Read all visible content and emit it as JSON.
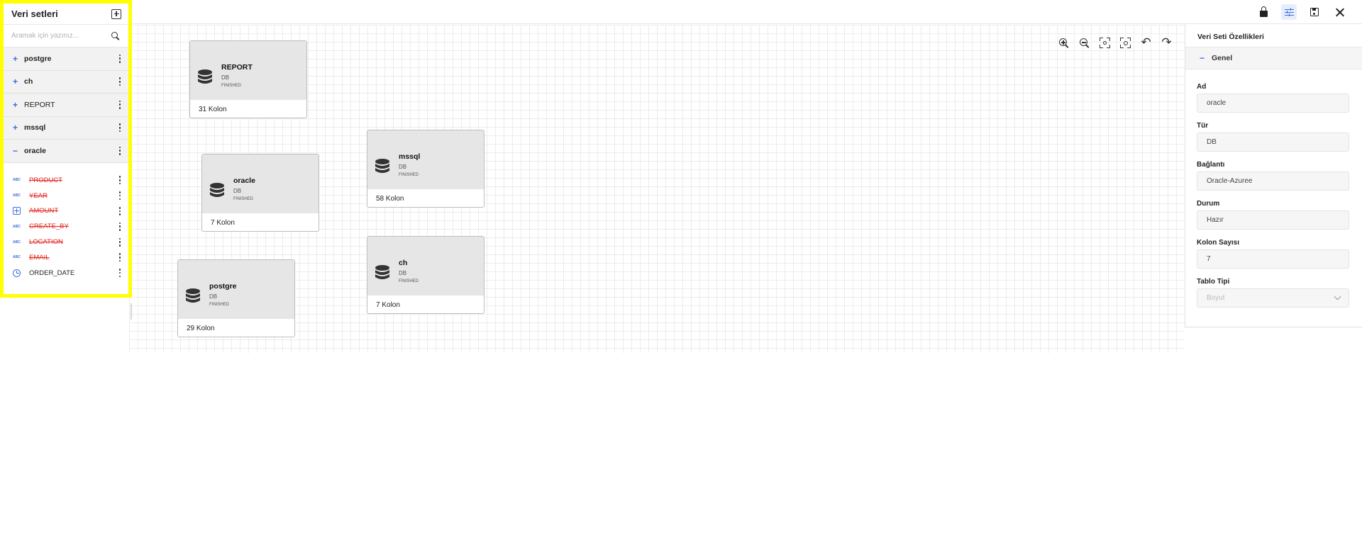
{
  "sidebar": {
    "title": "Veri setleri",
    "search_placeholder": "Aramak için yazınız...",
    "datasets": [
      {
        "sign": "+",
        "label": "postgre"
      },
      {
        "sign": "+",
        "label": "ch"
      },
      {
        "sign": "+",
        "label": "REPORT"
      },
      {
        "sign": "+",
        "label": "mssql"
      },
      {
        "sign": "−",
        "label": "oracle"
      }
    ],
    "columns": [
      {
        "type_icon": "abc-text-icon",
        "type_text": "ABC",
        "label": "PRODUCT"
      },
      {
        "type_icon": "abc-text-icon",
        "type_text": "ABC",
        "label": "YEAR"
      },
      {
        "type_icon": "number-icon",
        "type_text": "",
        "label": "AMOUNT"
      },
      {
        "type_icon": "abc-text-icon",
        "type_text": "ABC",
        "label": "CREATE_BY"
      },
      {
        "type_icon": "abc-text-icon",
        "type_text": "ABC",
        "label": "LOCATION"
      },
      {
        "type_icon": "abc-text-icon",
        "type_text": "ABC",
        "label": "EMAIL"
      },
      {
        "type_icon": "clock-icon",
        "type_text": "",
        "label": "ORDER_DATE"
      }
    ]
  },
  "canvas": {
    "nodes": [
      {
        "name": "REPORT",
        "type": "DB",
        "status": "FINISHED",
        "cols": "31 Kolon"
      },
      {
        "name": "oracle",
        "type": "DB",
        "status": "FINISHED",
        "cols": "7 Kolon"
      },
      {
        "name": "postgre",
        "type": "DB",
        "status": "FINISHED",
        "cols": "29 Kolon"
      },
      {
        "name": "mssql",
        "type": "DB",
        "status": "FINISHED",
        "cols": "58 Kolon"
      },
      {
        "name": "ch",
        "type": "DB",
        "status": "FINISHED",
        "cols": "7 Kolon"
      }
    ]
  },
  "panel": {
    "title": "Veri Seti Özellikleri",
    "section": "Genel",
    "fields": {
      "ad_label": "Ad",
      "ad_value": "oracle",
      "tur_label": "Tür",
      "tur_value": "DB",
      "baglanti_label": "Bağlantı",
      "baglanti_value": "Oracle-Azuree",
      "durum_label": "Durum",
      "durum_value": "Hazır",
      "kolon_label": "Kolon Sayısı",
      "kolon_value": "7",
      "tablo_label": "Tablo Tipi",
      "tablo_value": "Boyut"
    }
  },
  "colors": {
    "accent": "#3d6be0",
    "strike": "#e0271f",
    "highlight_border": "#ffff00"
  }
}
